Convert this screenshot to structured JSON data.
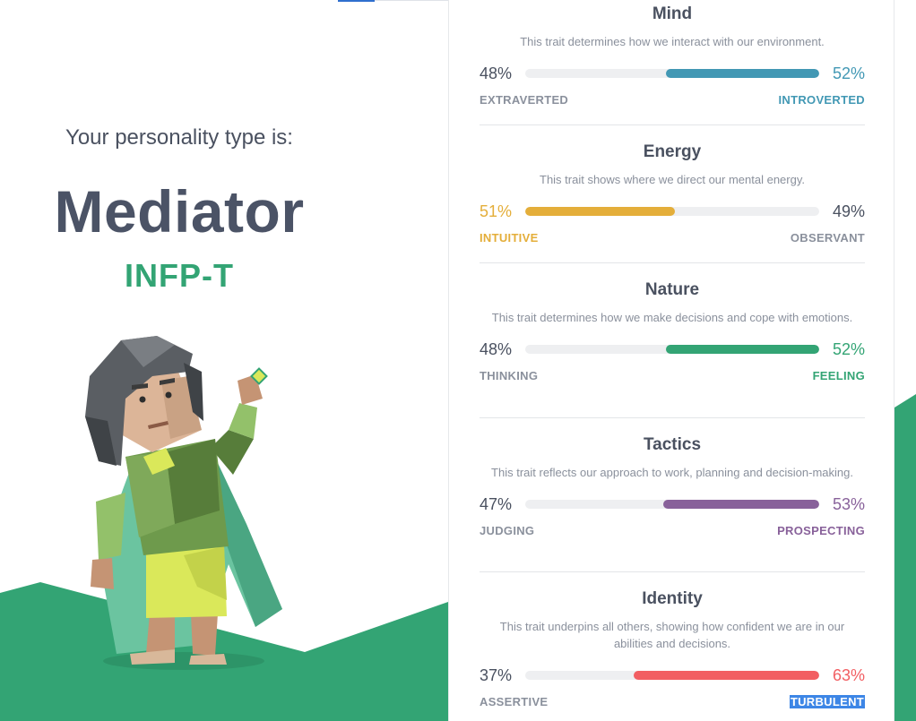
{
  "result": {
    "intro": "Your personality type is:",
    "type_name": "Mediator",
    "type_code": "INFP-T"
  },
  "colors": {
    "brand_green": "#33a474",
    "text_dark": "#4b5366",
    "mind": "#4298b4",
    "energy": "#e4ae3a",
    "nature": "#33a474",
    "tactics": "#88619a",
    "identity": "#f25e62",
    "selection": "#3d86e6"
  },
  "traits": [
    {
      "title": "Mind",
      "description": "This trait determines how we interact with our environment.",
      "left_percent": "48%",
      "right_percent": "52%",
      "left_label": "EXTRAVERTED",
      "right_label": "INTROVERTED",
      "dominant": "right",
      "dominant_fraction": 0.52
    },
    {
      "title": "Energy",
      "description": "This trait shows where we direct our mental energy.",
      "left_percent": "51%",
      "right_percent": "49%",
      "left_label": "INTUITIVE",
      "right_label": "OBSERVANT",
      "dominant": "left",
      "dominant_fraction": 0.51
    },
    {
      "title": "Nature",
      "description": "This trait determines how we make decisions and cope with emotions.",
      "left_percent": "48%",
      "right_percent": "52%",
      "left_label": "THINKING",
      "right_label": "FEELING",
      "dominant": "right",
      "dominant_fraction": 0.52
    },
    {
      "title": "Tactics",
      "description": "This trait reflects our approach to work, planning and decision-making.",
      "left_percent": "47%",
      "right_percent": "53%",
      "left_label": "JUDGING",
      "right_label": "PROSPECTING",
      "dominant": "right",
      "dominant_fraction": 0.53
    },
    {
      "title": "Identity",
      "description": "This trait underpins all others, showing how confident we are in our abilities and decisions.",
      "left_percent": "37%",
      "right_percent": "63%",
      "left_label": "ASSERTIVE",
      "right_label": "TURBULENT",
      "dominant": "right",
      "dominant_fraction": 0.63
    }
  ],
  "illustration": "mediator-character-icon"
}
